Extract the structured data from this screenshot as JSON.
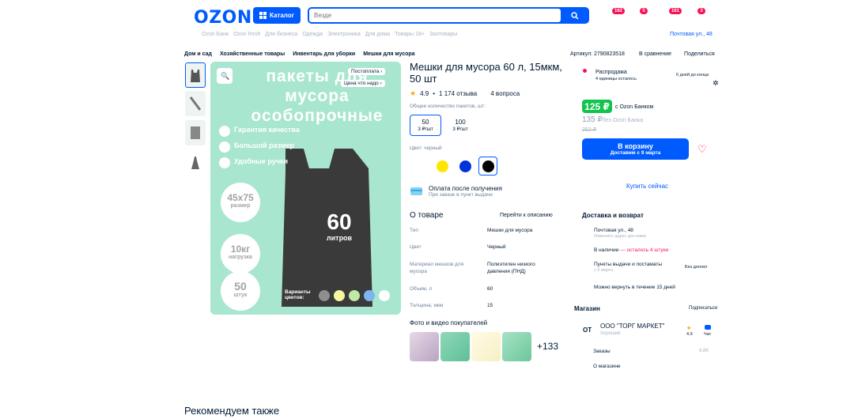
{
  "header": {
    "logo": "OZON",
    "catalog_label": "Каталог",
    "search_placeholder": "Везде",
    "badges": [
      "162",
      "5",
      "161",
      "3"
    ]
  },
  "subnav": {
    "items": [
      "Ozon Банк",
      "Ozon fresh",
      "Для бизнеса",
      "Одежда",
      "Электроника",
      "Для дома",
      "Товары 18+",
      "Зоотовары"
    ],
    "location": "Почтовая ул., 48"
  },
  "breadcrumb": [
    "Дом и сад",
    "Хозяйственные товары",
    "Инвентарь для уборки",
    "Мешки для мусора"
  ],
  "article": "Артикул: 2790823518",
  "actions": {
    "compare": "В сравнение",
    "share": "Поделиться"
  },
  "image_tags": {
    "postpay": "Постоплата",
    "price_check": "Цена что надо"
  },
  "image_text": {
    "headline1": "пакеты для мусора",
    "headline2": "особопрочные",
    "features": [
      "Гарантия качества",
      "Большой размер",
      "Удобные ручки"
    ],
    "volume_num": "60",
    "volume_unit": "литров",
    "size_val": "45x75",
    "size_label": "размер",
    "load_val": "10кг",
    "load_label": "нагрузка",
    "count_val": "50",
    "count_label": "штук",
    "colors_label": "Варианты цветов:"
  },
  "product": {
    "title": "Мешки для мусора 60 л, 15мкм, 50 шт",
    "rating": "4.9",
    "reviews": "1 174 отзыва",
    "questions": "4 вопроса",
    "pack_label": "Общее количество пакетов, шт:",
    "pack_options": [
      {
        "qty": "50",
        "price": "3 ₽/шт"
      },
      {
        "qty": "100",
        "price": "3 ₽/шт"
      }
    ],
    "color_label": "Цвет: черный",
    "colors": [
      "#ffe600",
      "#0033d9",
      "#000000"
    ],
    "pay_after_title": "Оплата после получения",
    "pay_after_sub": "При заказе в пункт выдачи"
  },
  "about": {
    "title": "О товаре",
    "link": "Перейти к описанию",
    "specs": [
      {
        "key": "Тип",
        "value": "Мешки для мусора"
      },
      {
        "key": "Цвет",
        "value": "Черный"
      },
      {
        "key": "Материал мешков для мусора",
        "value": "Полиэтилен низкого давления (ПНД)"
      },
      {
        "key": "Объем, л",
        "value": "60"
      },
      {
        "key": "Толщина, мкм",
        "value": "15"
      }
    ],
    "photos_title": "Фото и видео покупателей",
    "photos_more": "+133"
  },
  "sale": {
    "title": "Распродажа",
    "left": "4 единицы осталось",
    "days": "6 дней до конца"
  },
  "price": {
    "ozon_bank": "125 ₽",
    "ozon_bank_label": "c Ozon Банком",
    "regular": "135 ₽",
    "regular_label": "без Ozon Банка",
    "old": "252 ₽",
    "cart_label": "В корзину",
    "cart_sub": "Доставим с 9 марта",
    "buy_now": "Купить сейчас"
  },
  "delivery": {
    "title": "Доставка и возврат",
    "address": "Почтовая ул., 48",
    "address_sub": "Изменить адрес доставки",
    "stock": "В наличии",
    "stock_left": "осталось 4 штуки",
    "pickup": "Пункты выдачи и постаматы",
    "pickup_sub": "с 9 марта",
    "pickup_price": "Без доплат",
    "return": "Можно вернуть в течение 15 дней"
  },
  "shop": {
    "title": "Магазин",
    "subscribe": "Подписаться",
    "avatar": "ОТ",
    "name": "ООО \"ТОРГ МАРКЕТ\"",
    "status": "Хороший",
    "rating": "4.9",
    "chat": "Чат",
    "orders": "Заказы",
    "orders_count": "6.8К",
    "about": "О магазине"
  },
  "recommend": "Рекомендуем также"
}
